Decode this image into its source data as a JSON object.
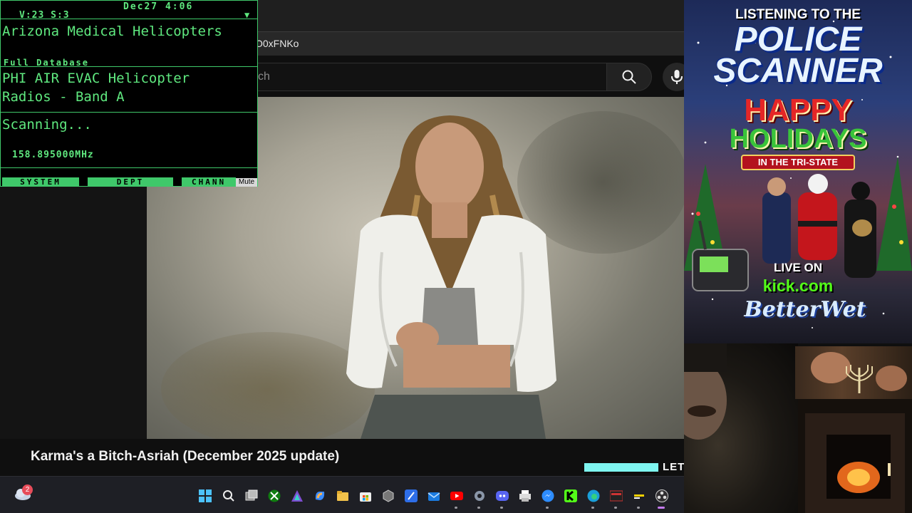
{
  "browser": {
    "url_fragment": "O0xFNKo",
    "search_placeholder": "ch",
    "video_title": "Karma's a Bitch-Asriah (December 2025 update)",
    "banner_text": "LET"
  },
  "scanner": {
    "volume_squelch": "V:23  S:3",
    "date_time": "Dec27  4:06",
    "system": "Arizona Medical Helicopters",
    "database": "Full Database",
    "department_line1": "PHI AIR EVAC Helicopter",
    "department_line2": "Radios - Band A",
    "status": "Scanning...",
    "frequency": "158.895000MHz",
    "softkeys": {
      "system": "SYSTEM",
      "dept": "DEPT",
      "chann": "CHANN",
      "mute": "Mute"
    },
    "color": "#5fe87f"
  },
  "promo": {
    "line1": "LISTENING TO THE",
    "line2": "POLICE",
    "line3": "SCANNER",
    "line4": "HAPPY",
    "line5": "HOLIDAYS",
    "line6": "IN THE TRI-STATE",
    "live_on": "LIVE ON",
    "platform": "kick.com",
    "signature": "BetterWet",
    "accent_red": "#e52626",
    "accent_green": "#39c43a",
    "kick_green": "#53fc18"
  },
  "taskbar": {
    "weather_badge": "2",
    "apps": [
      "windows-start",
      "search",
      "task-view",
      "xbox",
      "affinity",
      "copilot",
      "file-explorer",
      "microsoft-store",
      "app-cube",
      "affinity-publisher",
      "mail",
      "youtube",
      "settings",
      "discord",
      "print-manager",
      "messenger",
      "kick",
      "edge",
      "voicemeeter",
      "sticky-app",
      "obs"
    ]
  }
}
